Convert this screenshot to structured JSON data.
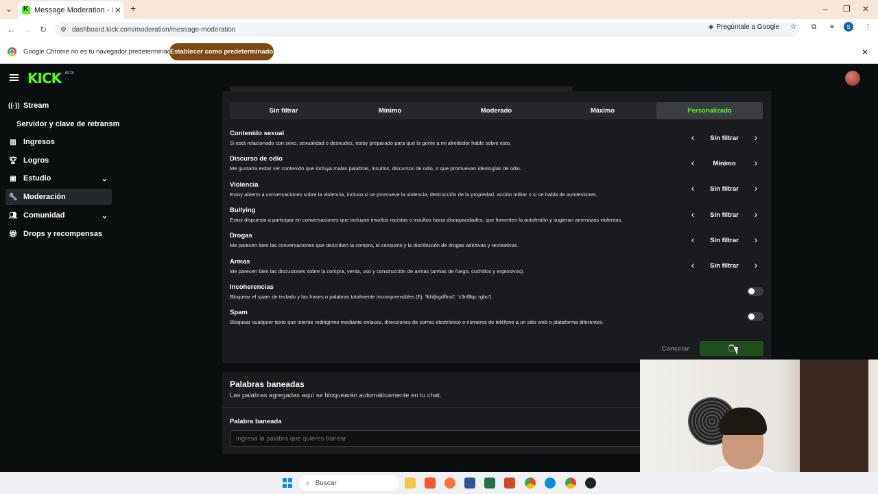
{
  "browser": {
    "tab_title": "Message Moderation - Kick Da",
    "url": "dashboard.kick.com/moderation/message-moderation",
    "ask_google": "Pregúntale a Google",
    "profile_initial": "S",
    "infobar_text": "Google Chrome no es tu navegador predeterminado",
    "infobar_button": "Establecer como predeterminado"
  },
  "app": {
    "logo": "KICK",
    "logo_badge": "BETA"
  },
  "sidebar": {
    "items": [
      {
        "label": "Stream",
        "icon": "broadcast-icon"
      },
      {
        "label": "Servidor y clave de retransm"
      },
      {
        "label": "Ingresos",
        "icon": "chart-icon"
      },
      {
        "label": "Logros",
        "icon": "trophy-icon"
      },
      {
        "label": "Estudio",
        "icon": "studio-icon"
      },
      {
        "label": "Moderación",
        "icon": "wrench-icon"
      },
      {
        "label": "Comunidad",
        "icon": "people-icon"
      },
      {
        "label": "Drops y recompensas",
        "icon": "gift-icon"
      }
    ]
  },
  "filters": {
    "tabs": [
      "Sin filtrar",
      "Mínimo",
      "Moderado",
      "Máximo",
      "Personalizado"
    ],
    "active": "Personalizado"
  },
  "categories": [
    {
      "title": "Contenido sexual",
      "desc": "Si está relacionado con sexo, sexualidad o desnudez, estoy preparado para que la gente a mi alrededor hable sobre esto.",
      "value": "Sin filtrar"
    },
    {
      "title": "Discurso de odio",
      "desc": "Me gustaría evitar ver contenido que incluya malas palabras, insultos, discursos de odio, o que promuevan ideologías de odio.",
      "value": "Mínimo"
    },
    {
      "title": "Violencia",
      "desc": "Estoy abierto a conversaciones sobre la violencia, incluso si se promueve la violencia, destrucción de la propiedad, acción militar o si se habla de autolesiones.",
      "value": "Sin filtrar"
    },
    {
      "title": "Bullying",
      "desc": "Estoy dispuesto a participar en conversaciones que incluyan insultos racistas o insultos hacia discapacidades, que fomenten la autolesión y sugieran amenazas violentas.",
      "value": "Sin filtrar"
    },
    {
      "title": "Drogas",
      "desc": "Me parecen bien las conversaciones que describen la compra, el consumo y la distribución de drogas adictivas y recreativas.",
      "value": "Sin filtrar"
    },
    {
      "title": "Armas",
      "desc": "Me parecen bien las discusiones sobre la compra, venta, uso y construcción de armas (armas de fuego, cuchillos y explosivos).",
      "value": "Sin filtrar"
    }
  ],
  "toggles": [
    {
      "title": "Incoherencias",
      "desc": "Bloquear el spam de teclado y las frases o palabras totalmente incomprensibles (Ej: 'fkhfjkgdfhsd', 'c3nf$qc rgbu').",
      "on": false
    },
    {
      "title": "Spam",
      "desc": "Bloquear cualquier texto que intente redirigirme mediante enlaces, direcciones de correo electrónico o números de teléfono a un sitio web o plataforma diferentes.",
      "on": false
    }
  ],
  "actions": {
    "cancel": "Cancelar"
  },
  "banned_words": {
    "title": "Palabras baneadas",
    "subtitle": "Las palabras agregadas aquí se bloquearán automáticamente en tu chat.",
    "field_label": "Palabra baneada",
    "placeholder": "Ingresa la palabra que quieres banear"
  },
  "taskbar": {
    "search": "Buscar"
  }
}
